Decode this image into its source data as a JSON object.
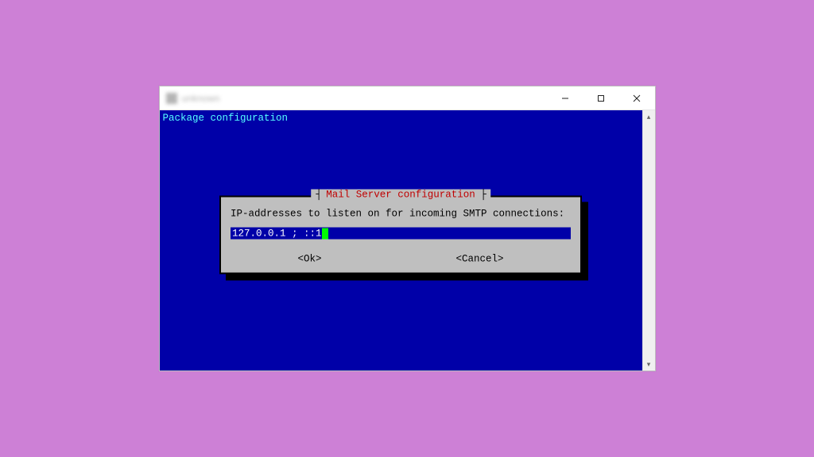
{
  "window": {
    "title": "unknown"
  },
  "terminal": {
    "header": "Package configuration"
  },
  "dialog": {
    "title": "Mail Server configuration",
    "prompt": "IP-addresses to listen on for incoming SMTP connections:",
    "input_value": "127.0.0.1 ; ::1",
    "ok_label": "<Ok>",
    "cancel_label": "<Cancel>"
  }
}
